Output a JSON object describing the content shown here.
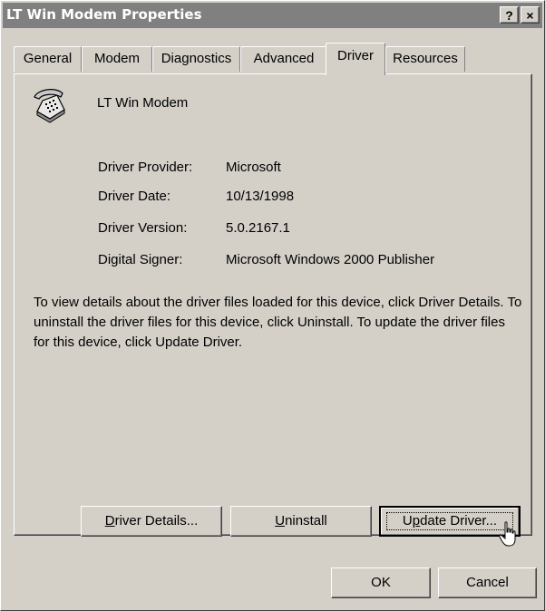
{
  "window": {
    "title": "LT Win Modem Properties",
    "help_glyph": "?",
    "close_glyph": "×"
  },
  "tabs": [
    {
      "label": "General"
    },
    {
      "label": "Modem"
    },
    {
      "label": "Diagnostics"
    },
    {
      "label": "Advanced"
    },
    {
      "label": "Driver"
    },
    {
      "label": "Resources"
    }
  ],
  "device": {
    "name": "LT Win Modem",
    "icon": "phone-modem-icon"
  },
  "properties": [
    {
      "label": "Driver Provider:",
      "value": "Microsoft"
    },
    {
      "label": "Driver Date:",
      "value": "10/13/1998"
    },
    {
      "label": "Driver Version:",
      "value": "5.0.2167.1"
    },
    {
      "label": "Digital Signer:",
      "value": "Microsoft Windows 2000 Publisher"
    }
  ],
  "description": "To view details about the driver files loaded for this device, click Driver Details. To uninstall the driver files for this device, click Uninstall. To update the driver files for this device, click Update Driver.",
  "buttons": {
    "driver_details": {
      "pre": "",
      "key": "D",
      "post": "river Details..."
    },
    "uninstall": {
      "pre": "",
      "key": "U",
      "post": "ninstall"
    },
    "update_driver": {
      "pre": "U",
      "key": "p",
      "post": "date Driver..."
    },
    "ok": "OK",
    "cancel": "Cancel"
  }
}
